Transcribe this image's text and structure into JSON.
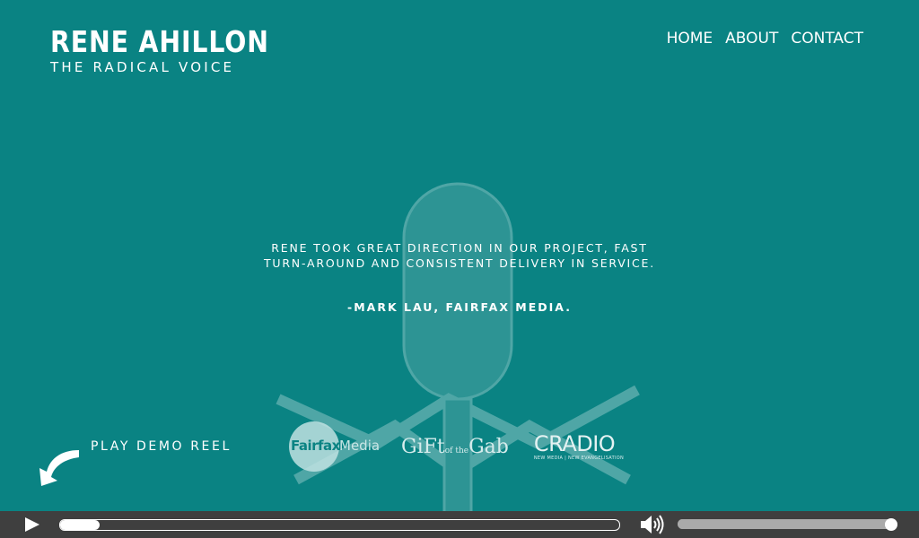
{
  "brand": {
    "name": "RENE AHILLON",
    "tagline": "THE RADICAL VOICE"
  },
  "nav": {
    "items": [
      {
        "label": "HOME"
      },
      {
        "label": "ABOUT"
      },
      {
        "label": "CONTACT"
      }
    ]
  },
  "testimonial": {
    "line1": "RENE TOOK GREAT DIRECTION IN OUR PROJECT, FAST",
    "line2": "TURN-AROUND AND CONSISTENT DELIVERY IN SERVICE.",
    "author": "-MARK LAU, FAIRFAX MEDIA."
  },
  "demo": {
    "label": "PLAY DEMO REEL",
    "icon": "curved-arrow-icon"
  },
  "logos": {
    "fairfax": {
      "brand": "Fairfax",
      "suffix": "Media"
    },
    "gab": {
      "part1": "GiFt",
      "part2": "of the",
      "part3": "Gab"
    },
    "cradio": {
      "main": "CRADIO",
      "sub": "NEW MEDIA | NEW EVANGELISATION"
    }
  },
  "player": {
    "progress": 0.07,
    "volume": 1.0,
    "icons": [
      "play-icon",
      "volume-icon"
    ]
  },
  "colors": {
    "background": "#008080",
    "player_bar": "#3f3f3f",
    "text": "#ffffff"
  }
}
